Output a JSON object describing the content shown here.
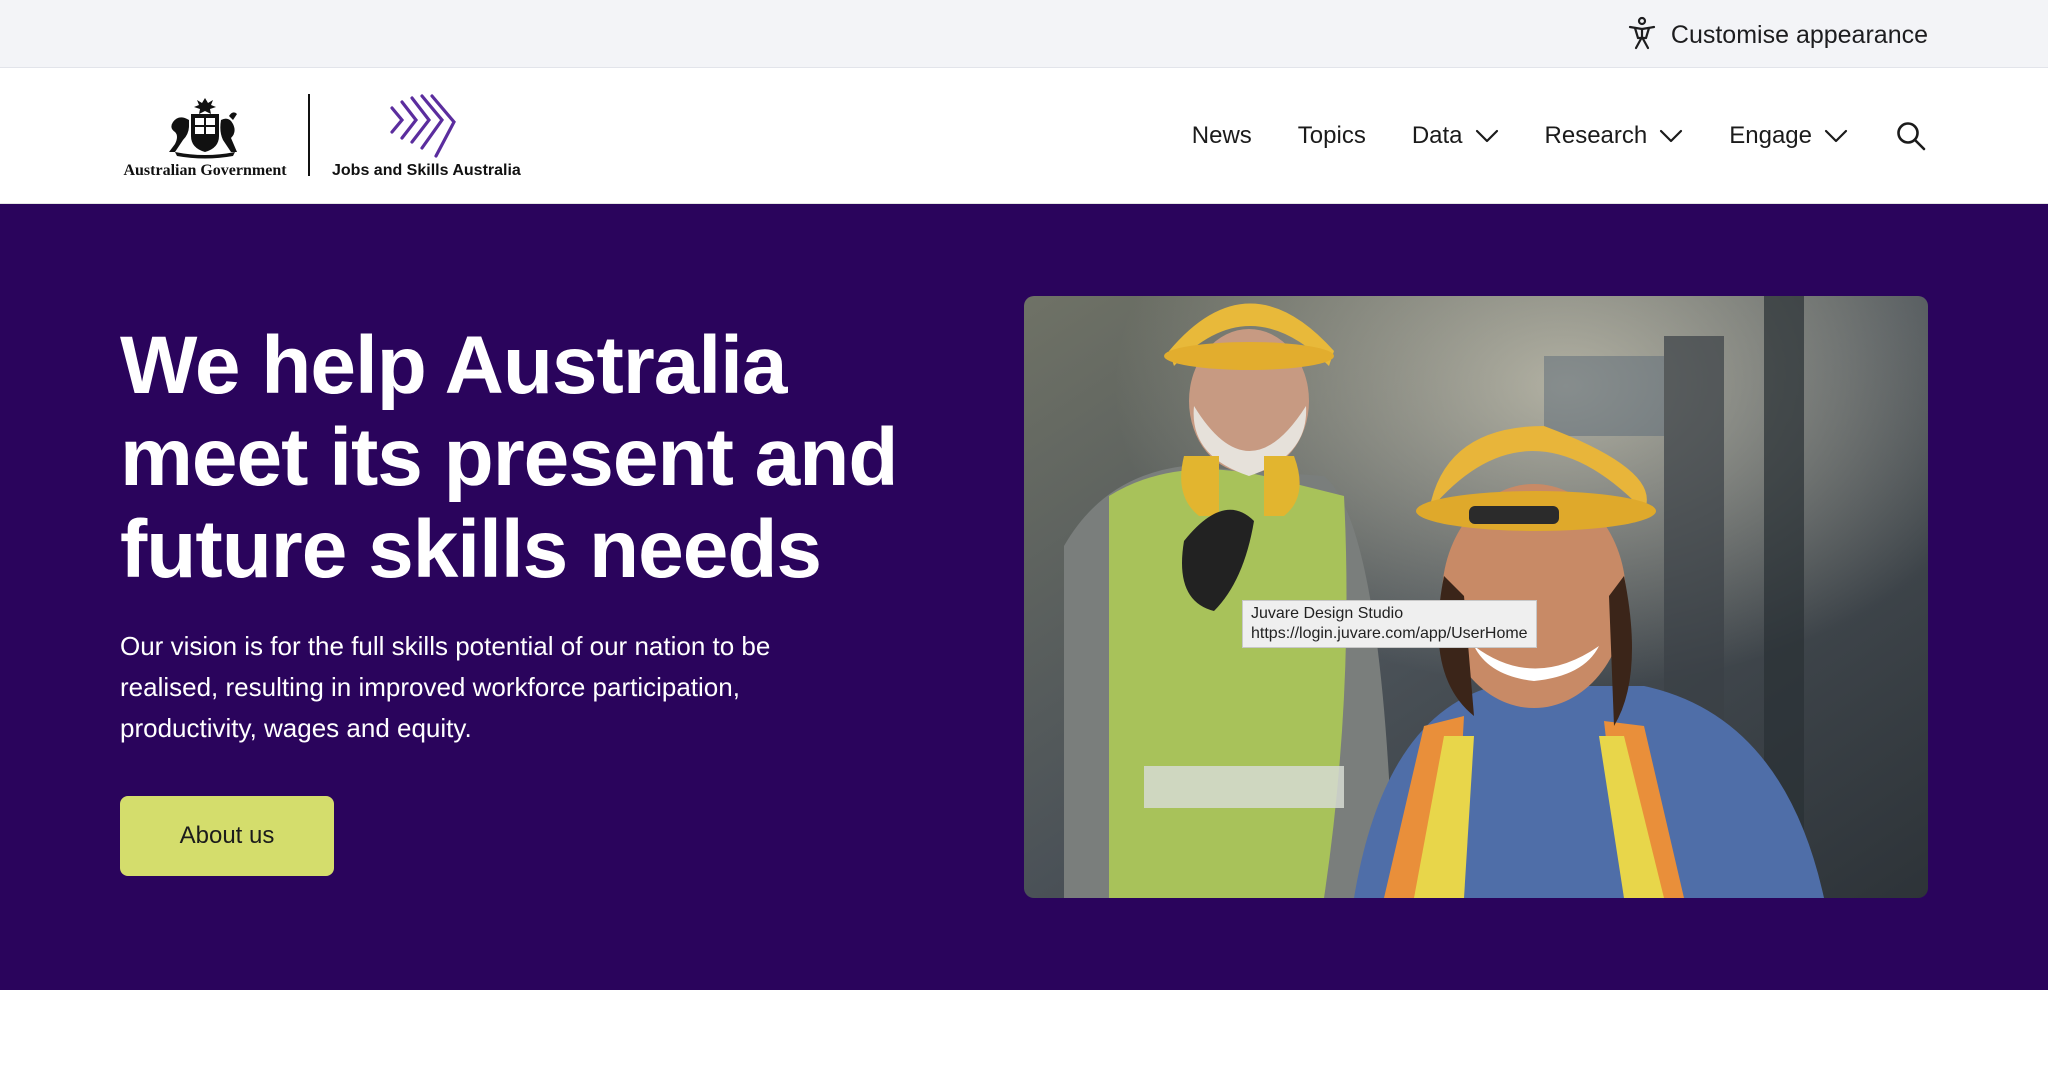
{
  "utility": {
    "customise_label": "Customise appearance",
    "icon": "accessibility-person-icon"
  },
  "logo": {
    "government_text": "Australian Government",
    "agency_text": "Jobs and Skills Australia",
    "crest_icon": "coat-of-arms-icon",
    "mark_icon": "chevron-arrows-logo-icon"
  },
  "nav": {
    "items": [
      {
        "label": "News",
        "dropdown": false
      },
      {
        "label": "Topics",
        "dropdown": false
      },
      {
        "label": "Data",
        "dropdown": true
      },
      {
        "label": "Research",
        "dropdown": true
      },
      {
        "label": "Engage",
        "dropdown": true
      }
    ],
    "search_icon": "search-icon"
  },
  "hero": {
    "title_line1": "We help Australia",
    "title_line2": "meet its present and",
    "title_line3": "future skills needs",
    "text": "Our vision is for the full skills potential of our nation to be realised, resulting in improved workforce participation, productivity, wages and equity.",
    "button_label": "About us"
  },
  "tooltip": {
    "line1": "Juvare Design Studio",
    "line2": "https://login.juvare.com/app/UserHome"
  },
  "colors": {
    "hero_bg": "#2a045c",
    "button_bg": "#d4dd6c",
    "brand_purple": "#5b2d9e",
    "utility_bg": "#f3f4f7"
  }
}
